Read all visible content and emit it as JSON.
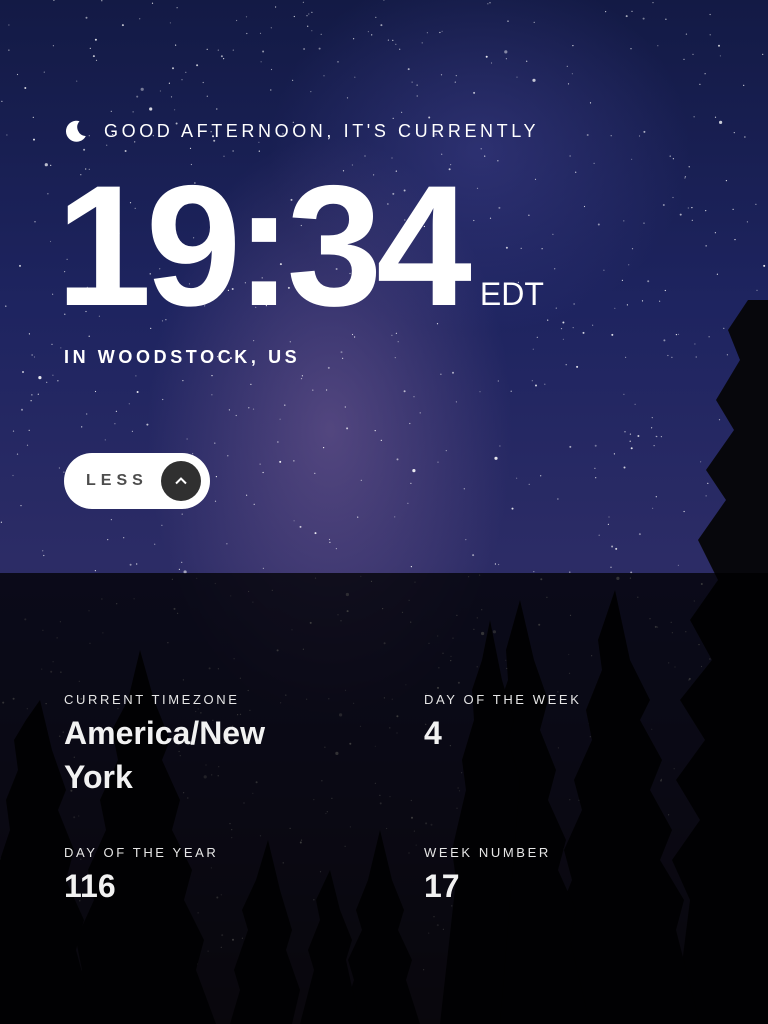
{
  "greeting": {
    "text": "GOOD AFTERNOON, IT'S CURRENTLY",
    "icon": "moon-icon"
  },
  "clock": {
    "time": "19:34",
    "timezone_abbr": "EDT",
    "location": "IN WOODSTOCK, US"
  },
  "toggle": {
    "label": "LESS",
    "icon": "chevron-up-icon"
  },
  "details": {
    "current_timezone": {
      "label": "CURRENT TIMEZONE",
      "value": "America/New York"
    },
    "day_of_week": {
      "label": "DAY OF THE WEEK",
      "value": "4"
    },
    "day_of_year": {
      "label": "DAY OF THE YEAR",
      "value": "116"
    },
    "week_number": {
      "label": "WEEK NUMBER",
      "value": "17"
    }
  },
  "colors": {
    "text": "#ffffff",
    "toggle_bg": "#ffffff",
    "toggle_button": "#303030",
    "toggle_text": "#4d4d4d",
    "panel_overlay": "rgba(0,0,0,0.75)"
  }
}
